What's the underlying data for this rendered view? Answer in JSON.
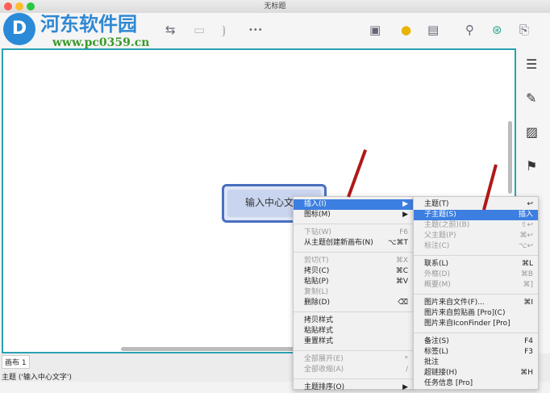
{
  "window": {
    "title": "无标题"
  },
  "watermark": {
    "name": "河东软件园",
    "url": "www.pc0359.cn"
  },
  "toolbar": {
    "more": "•••"
  },
  "topic": {
    "text": "输入中心文字"
  },
  "bottom": {
    "tab": "画布 1",
    "status": "主题 ('输入中心文字')"
  },
  "menu": [
    [
      {
        "label": "插入(I)",
        "sc": "▶",
        "sel": true
      },
      {
        "label": "图标(M)",
        "sc": "▶"
      }
    ],
    [
      {
        "label": "下钻(W)",
        "sc": "F6",
        "dis": true
      },
      {
        "label": "从主题创建新画布(N)",
        "sc": "⌥⌘T"
      }
    ],
    [
      {
        "label": "剪切(T)",
        "sc": "⌘X",
        "dis": true
      },
      {
        "label": "拷贝(C)",
        "sc": "⌘C"
      },
      {
        "label": "粘贴(P)",
        "sc": "⌘V"
      },
      {
        "label": "复制(L)",
        "dis": true
      },
      {
        "label": "删除(D)",
        "sc": "⌫"
      }
    ],
    [
      {
        "label": "拷贝样式"
      },
      {
        "label": "粘贴样式"
      },
      {
        "label": "重置样式"
      }
    ],
    [
      {
        "label": "全部展开(E)",
        "sc": "*",
        "dis": true
      },
      {
        "label": "全部收缩(A)",
        "sc": "/",
        "dis": true
      }
    ],
    [
      {
        "label": "主题排序(O)",
        "sc": "▶"
      }
    ]
  ],
  "submenu": [
    [
      {
        "label": "主题(T)",
        "sc": "↩"
      },
      {
        "label": "子主题(S)",
        "sc": "插入",
        "sel": true
      },
      {
        "label": "主题(之前)(B)",
        "sc": "⇧↩",
        "dis": true
      },
      {
        "label": "父主题(P)",
        "sc": "⌘↩",
        "dis": true
      },
      {
        "label": "标注(C)",
        "sc": "⌥↩",
        "dis": true
      }
    ],
    [
      {
        "label": "联系(L)",
        "sc": "⌘L"
      },
      {
        "label": "外框(D)",
        "sc": "⌘B",
        "dis": true
      },
      {
        "label": "概要(M)",
        "sc": "⌘]",
        "dis": true
      }
    ],
    [
      {
        "label": "图片来自文件(F)...",
        "sc": "⌘I"
      },
      {
        "label": "图片来自剪贴画 [Pro](C)"
      },
      {
        "label": "图片来自IconFinder [Pro]"
      }
    ],
    [
      {
        "label": "备注(S)",
        "sc": "F4"
      },
      {
        "label": "标签(L)",
        "sc": "F3"
      },
      {
        "label": "批注"
      },
      {
        "label": "超链接(H)",
        "sc": "⌘H"
      },
      {
        "label": "任务信息 [Pro]"
      }
    ]
  ]
}
